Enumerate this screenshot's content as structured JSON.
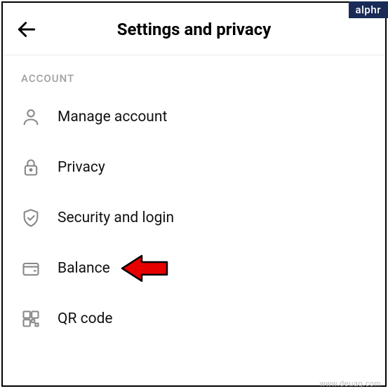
{
  "badge": "alphr",
  "header": {
    "title": "Settings and privacy"
  },
  "section_label": "ACCOUNT",
  "menu": {
    "items": [
      {
        "label": "Manage account",
        "icon": "user-icon"
      },
      {
        "label": "Privacy",
        "icon": "lock-icon"
      },
      {
        "label": "Security and login",
        "icon": "shield-icon"
      },
      {
        "label": "Balance",
        "icon": "wallet-icon"
      },
      {
        "label": "QR code",
        "icon": "qr-icon"
      }
    ]
  },
  "annotation": {
    "arrow_target_index": 3
  },
  "watermark": "www.deuaq.com"
}
